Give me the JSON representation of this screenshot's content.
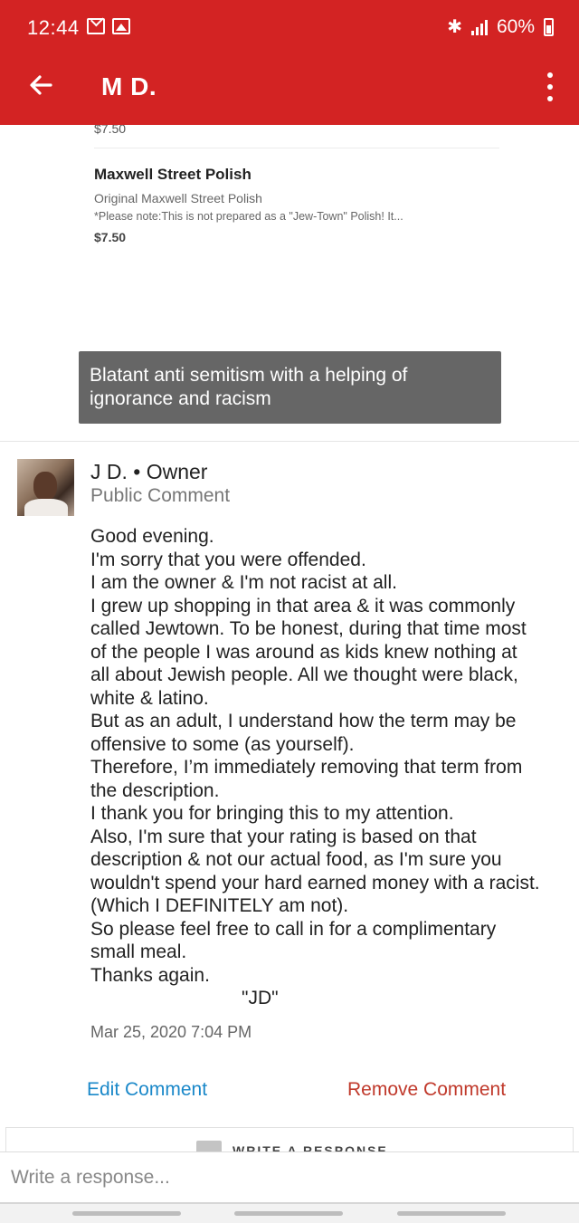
{
  "status_bar": {
    "time": "12:44",
    "battery": "60%",
    "icons": [
      "mail-icon",
      "image-icon",
      "bluetooth-icon",
      "signal-icon",
      "battery-icon"
    ]
  },
  "header": {
    "title": "M D.",
    "background_color": "#d32323"
  },
  "menu_screenshot": {
    "previous_price": "$7.50",
    "item_name": "Maxwell Street Polish",
    "item_description": "Original Maxwell Street Polish",
    "item_note": "*Please note:This is not prepared as a \"Jew-Town\" Polish! It...",
    "item_price": "$7.50"
  },
  "review_caption": "Blatant anti semitism with a helping of ignorance and racism",
  "comment": {
    "author": "J D. • Owner",
    "type": "Public Comment",
    "lines": [
      "Good evening.",
      "I'm sorry that you were offended.",
      "I am the owner & I'm not racist at all.",
      "I grew up shopping in that area & it was commonly",
      "called Jewtown. To be honest, during that time most",
      "of the people I was around as kids knew nothing at",
      "all about Jewish people. All we thought were black,",
      "white & latino.",
      "But as an adult, I understand how the term may be",
      "offensive to some (as yourself).",
      "Therefore, I’m immediately removing that term from",
      "the description.",
      "I thank you for bringing this to my attention.",
      "Also, I'm sure that your rating is based on that",
      "description & not our actual food, as I'm sure you",
      "wouldn't spend your hard earned money with a racist.",
      "(Which I DEFINITELY am not).",
      "So please feel free to call in for a complimentary",
      "small meal.",
      "Thanks again."
    ],
    "signature": "\"JD\"",
    "date": "Mar 25, 2020 7:04 PM",
    "edit_label": "Edit Comment",
    "remove_label": "Remove Comment",
    "edit_color": "#1a88c9",
    "remove_color": "#c0392b"
  },
  "respond": {
    "label": "WRITE A RESPONSE",
    "placeholder": "Write a response..."
  }
}
